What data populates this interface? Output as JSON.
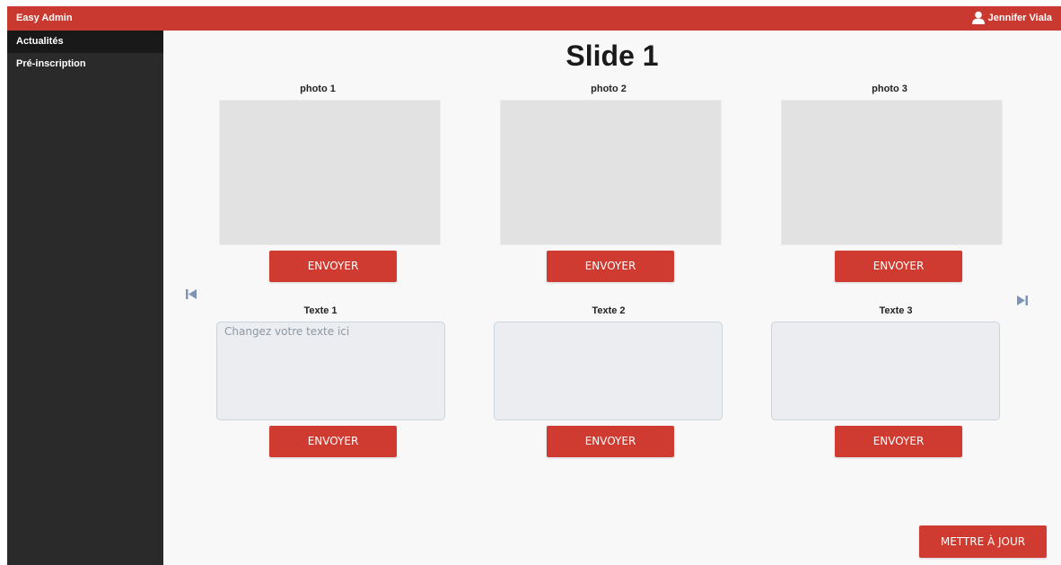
{
  "topbar": {
    "brand": "Easy Admin",
    "user_name": "Jennifer Viala",
    "user_icon": "user-icon"
  },
  "sidebar": {
    "items": [
      {
        "label": "Actualités",
        "active": true
      },
      {
        "label": "Pré-inscription",
        "active": false
      }
    ]
  },
  "main": {
    "title": "Slide 1",
    "photos": [
      {
        "label": "photo 1",
        "button": "ENVOYER"
      },
      {
        "label": "photo 2",
        "button": "ENVOYER"
      },
      {
        "label": "photo 3",
        "button": "ENVOYER"
      }
    ],
    "texts": [
      {
        "label": "Texte 1",
        "value": "",
        "placeholder": "Changez votre texte ici",
        "button": "ENVOYER"
      },
      {
        "label": "Texte 2",
        "value": "",
        "placeholder": "",
        "button": "ENVOYER"
      },
      {
        "label": "Texte 3",
        "value": "",
        "placeholder": "",
        "button": "ENVOYER"
      }
    ],
    "prev_icon": "skip-previous-icon",
    "next_icon": "skip-next-icon",
    "update_button": "METTRE À JOUR"
  },
  "colors": {
    "accent": "#c9392f",
    "sidebar": "#2a2a2a",
    "sidebar_active": "#191919",
    "background": "#f8f8f8"
  }
}
